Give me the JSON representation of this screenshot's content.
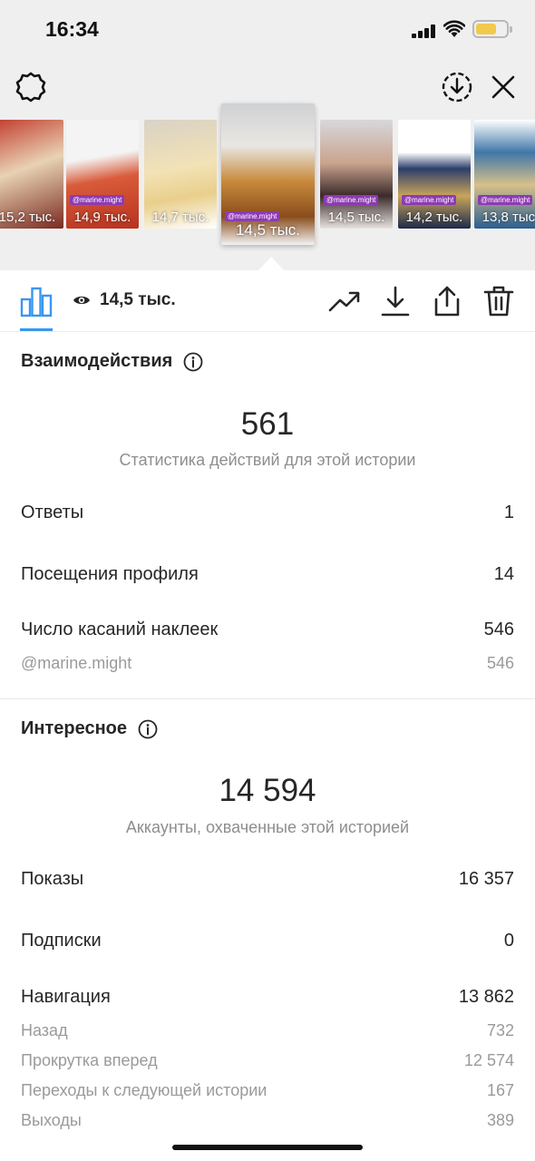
{
  "status_bar": {
    "time": "16:34",
    "battery_level": 0.7
  },
  "colors": {
    "accent": "#3897f0",
    "tag_purple": "#8e3ab3",
    "muted_text": "#8e8e8e"
  },
  "top_icons": [
    "settings-icon",
    "download-circle-icon",
    "close-icon"
  ],
  "stories": [
    {
      "views": "15,2 тыс.",
      "tag": ""
    },
    {
      "views": "14,9 тыс.",
      "tag": "@marine.might"
    },
    {
      "views": "14,7 тыс.",
      "tag": ""
    },
    {
      "views": "14,5 тыс.",
      "tag": "@marine.might"
    },
    {
      "views": "14,5 тыс.",
      "tag": "@marine.might"
    },
    {
      "views": "14,2 тыс.",
      "tag": "@marine.might"
    },
    {
      "views": "13,8 тыс.",
      "tag": "@marine.might"
    }
  ],
  "toolbar": {
    "viewers_count": "14,5 тыс.",
    "icons": [
      "bar-chart-icon",
      "eye-icon",
      "trend-icon",
      "download-icon",
      "share-icon",
      "trash-icon"
    ]
  },
  "interactions": {
    "title": "Взаимодействия",
    "total": "561",
    "caption": "Статистика действий для этой истории",
    "rows": [
      {
        "label": "Ответы",
        "value": "1"
      },
      {
        "label": "Посещения профиля",
        "value": "14"
      },
      {
        "label": "Число касаний наклеек",
        "value": "546"
      }
    ],
    "sub_rows": [
      {
        "label": "@marine.might",
        "value": "546"
      }
    ]
  },
  "discovery": {
    "title": "Интересное",
    "total": "14 594",
    "caption": "Аккаунты, охваченные этой историей",
    "rows": [
      {
        "label": "Показы",
        "value": "16 357"
      },
      {
        "label": "Подписки",
        "value": "0"
      },
      {
        "label": "Навигация",
        "value": "13 862"
      }
    ],
    "sub_rows": [
      {
        "label": "Назад",
        "value": "732"
      },
      {
        "label": "Прокрутка вперед",
        "value": "12 574"
      },
      {
        "label": "Переходы к следующей истории",
        "value": "167"
      },
      {
        "label": "Выходы",
        "value": "389"
      }
    ]
  }
}
